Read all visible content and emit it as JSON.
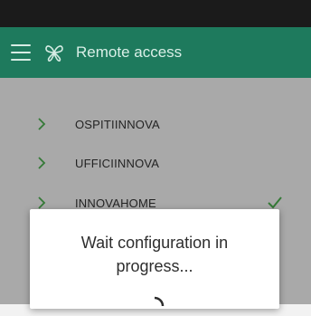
{
  "app_bar": {
    "title": "Remote access",
    "menu_icon": "hamburger-menu-icon",
    "logo_icon": "butterfly-logo-icon"
  },
  "colors": {
    "primary": "#1e7a5d",
    "accent": "#4caf50",
    "status_bar": "#1b1b1b",
    "list_background": "#f2f2f2"
  },
  "networks": [
    {
      "label": "OSPITIINNOVA",
      "selected": false
    },
    {
      "label": "UFFICIINNOVA",
      "selected": false
    },
    {
      "label": "INNOVAHOME",
      "selected": true
    }
  ],
  "dialog": {
    "message": "Wait configuration in progress...",
    "loading_icon": "spinner-icon"
  }
}
